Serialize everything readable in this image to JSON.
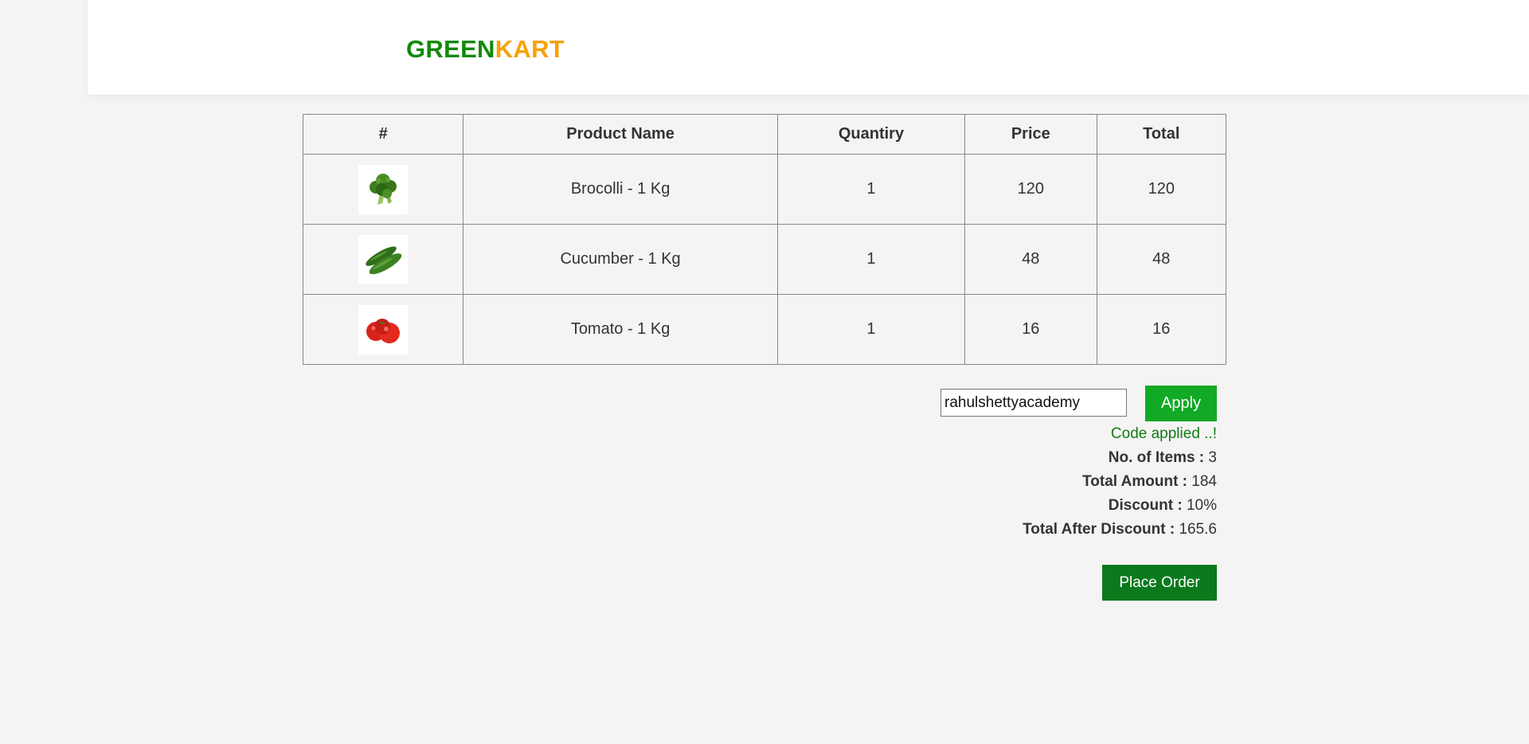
{
  "brand": {
    "part1": "GREEN",
    "part2": "KART",
    "colors": {
      "green": "#128a0a",
      "orange": "#f7a10a"
    }
  },
  "table": {
    "headers": [
      "#",
      "Product Name",
      "Quantiry",
      "Price",
      "Total"
    ],
    "rows": [
      {
        "image": "broccoli-image",
        "name": "Brocolli - 1 Kg",
        "quantity": "1",
        "price": "120",
        "total": "120"
      },
      {
        "image": "cucumber-image",
        "name": "Cucumber - 1 Kg",
        "quantity": "1",
        "price": "48",
        "total": "48"
      },
      {
        "image": "tomato-image",
        "name": "Tomato - 1 Kg",
        "quantity": "1",
        "price": "16",
        "total": "16"
      }
    ]
  },
  "promo": {
    "code_value": "rahulshettyacademy",
    "apply_label": "Apply",
    "status": "Code applied ..!"
  },
  "summary": {
    "items_label": "No. of Items :",
    "items_value": "3",
    "amount_label": "Total Amount :",
    "amount_value": "184",
    "discount_label": "Discount :",
    "discount_value": "10%",
    "after_label": "Total After Discount :",
    "after_value": "165.6"
  },
  "place_order_label": "Place Order",
  "colors": {
    "apply_button": "#12a925",
    "place_order_button": "#0b7a1d",
    "promo_info": "#137b13"
  }
}
